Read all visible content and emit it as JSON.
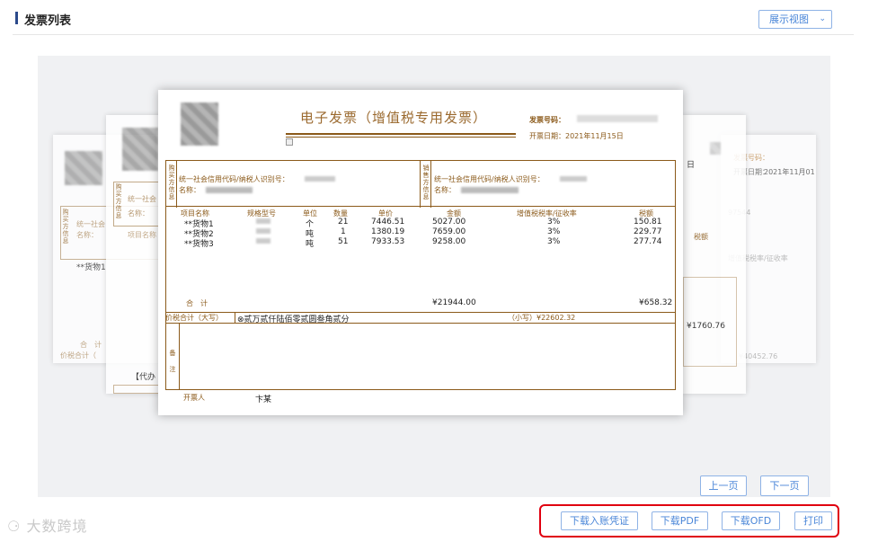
{
  "header": {
    "title": "发票列表",
    "view_button": "展示视图",
    "view_arrow": "⌄"
  },
  "invoice": {
    "title": "电子发票（增值税专用发票）",
    "no_label": "发票号码：",
    "date_label": "开票日期：2021年11月15日",
    "buyer_side": "购买方信息",
    "seller_side": "销售方信息",
    "credit_label": "统一社会信用代码/纳税人识别号：",
    "name_label": "名称：",
    "columns": [
      "项目名称",
      "规格型号",
      "单位",
      "数量",
      "单价",
      "金额",
      "增值税税率/征收率",
      "税额"
    ],
    "items": [
      {
        "name": "**货物1",
        "unit": "个",
        "qty": "21",
        "price": "7446.51",
        "amount": "5027.00",
        "rate": "3%",
        "tax": "150.81"
      },
      {
        "name": "**货物2",
        "unit": "吨",
        "qty": "1",
        "price": "1380.19",
        "amount": "7659.00",
        "rate": "3%",
        "tax": "229.77"
      },
      {
        "name": "**货物3",
        "unit": "吨",
        "qty": "51",
        "price": "7933.53",
        "amount": "9258.00",
        "rate": "3%",
        "tax": "277.74"
      }
    ],
    "total_label": "合　计",
    "total_amount": "¥21944.00",
    "total_tax": "¥658.32",
    "cap_label": "价税合计（大写）",
    "cap_value": "⊗贰万贰仟陆佰零贰圆叁角贰分",
    "small_label": "（小写）¥22602.32",
    "remark_label": "备注",
    "issuer_label": "开票人",
    "issuer_name": "卞某"
  },
  "back_left": {
    "item": "**货物1",
    "name_frag": "名称：",
    "credit_frag": "统一社会",
    "total_frag": "合　计",
    "cap_frag": "价税合计（",
    "agent_frag": "【代办"
  },
  "back_right": {
    "date_frag": "2021年11月01",
    "id_frag": "97544",
    "amt_frag": "¥1760.76",
    "amt2_frag": "¥40452.76",
    "tax_frag": "税额",
    "rate_frag": "增值税税率/征收率",
    "date_label_frag": "开票日期：",
    "no_label_frag": "发票号码：",
    "side_frag": "日"
  },
  "pager": {
    "prev": "上一页",
    "next": "下一页"
  },
  "actions": {
    "voucher": "下载入账凭证",
    "pdf": "下载PDF",
    "ofd": "下载OFD",
    "print": "打印"
  },
  "watermark": "大数跨境"
}
